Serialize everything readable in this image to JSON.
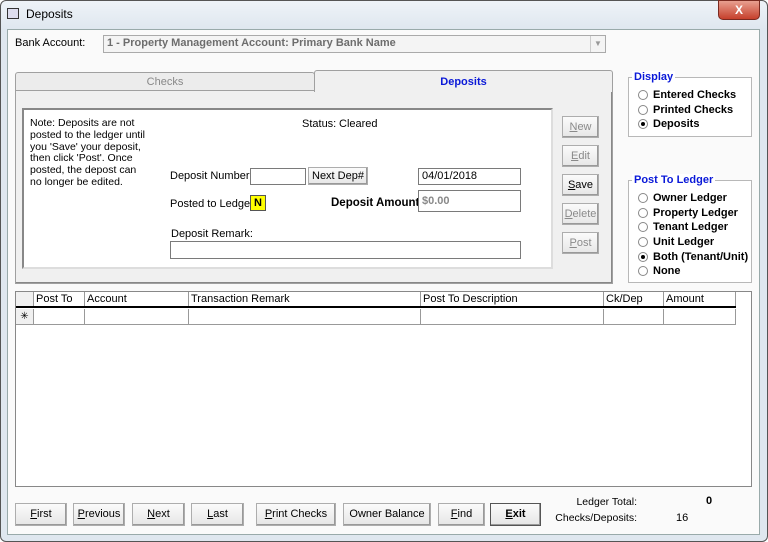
{
  "window": {
    "title": "Deposits",
    "close": "X"
  },
  "bank_account": {
    "label": "Bank Account:",
    "value": "1 - Property Management Account: Primary Bank Name"
  },
  "tabs": [
    {
      "label": "Checks"
    },
    {
      "label": "Deposits"
    }
  ],
  "note": "Note: Deposits are not posted to the ledger until you 'Save' your deposit, then click 'Post'. Once posted, the depost can no longer be edited.",
  "status": {
    "label": "Status:",
    "value": "Cleared"
  },
  "form": {
    "deposit_number_label": "Deposit Number:",
    "deposit_number": "",
    "next_dep": "Next Dep#",
    "date": "04/01/2018",
    "posted_label": "Posted to Ledger:",
    "posted_value": "N",
    "amount_label": "Deposit Amount:",
    "amount": "$0.00",
    "remark_label": "Deposit Remark:",
    "remark": ""
  },
  "side_buttons": [
    {
      "key": "N",
      "rest": "ew"
    },
    {
      "key": "E",
      "rest": "dit"
    },
    {
      "key": "S",
      "rest": "ave"
    },
    {
      "key": "D",
      "rest": "elete"
    },
    {
      "key": "P",
      "rest": "ost"
    }
  ],
  "display": {
    "title": "Display",
    "options": [
      "Entered Checks",
      "Printed Checks",
      "Deposits"
    ],
    "selected": 2
  },
  "post_to_ledger": {
    "title": "Post To Ledger",
    "options": [
      "Owner Ledger",
      "Property Ledger",
      "Tenant Ledger",
      "Unit Ledger",
      "Both (Tenant/Unit)",
      "None"
    ],
    "selected": 4
  },
  "grid": {
    "columns": [
      "Post To",
      "Account",
      "Transaction Remark",
      "Post To Description",
      "Ck/Dep",
      "Amount"
    ],
    "new_row_marker": "✳"
  },
  "bottom_buttons": [
    {
      "key": "F",
      "rest": "irst"
    },
    {
      "key": "P",
      "rest": "revious"
    },
    {
      "key": "N",
      "rest": "ext"
    },
    {
      "key": "L",
      "rest": "ast"
    },
    {
      "key": "P",
      "rest": "rint Checks"
    },
    {
      "key": "",
      "rest": "Owner Balance"
    },
    {
      "key": "F",
      "rest": "ind"
    },
    {
      "key": "E",
      "rest": "xit"
    }
  ],
  "totals": {
    "ledger_total_label": "Ledger Total:",
    "ledger_total": "0",
    "checks_deposits_label": "Checks/Deposits:",
    "checks_deposits": "16"
  }
}
